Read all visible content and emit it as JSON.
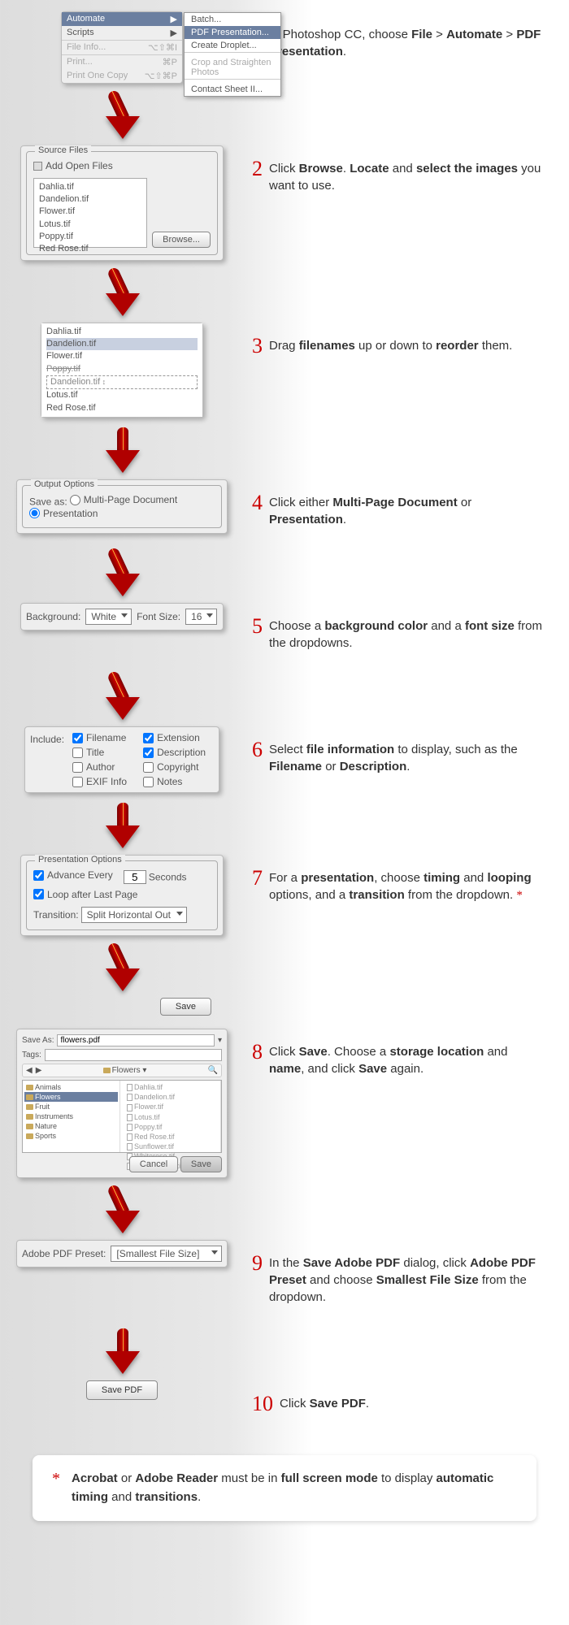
{
  "step1": {
    "menu": {
      "items": [
        {
          "label": "Automate",
          "highlight": true
        },
        {
          "label": "Scripts"
        },
        {
          "label": "File Info...",
          "shortcut": "⌥⇧⌘I",
          "dim": true
        },
        {
          "label": "Print...",
          "shortcut": "⌘P",
          "dim": true
        },
        {
          "label": "Print One Copy",
          "shortcut": "⌥⇧⌘P",
          "dim": true
        }
      ],
      "submenu": [
        "Batch...",
        "PDF Presentation...",
        "Create Droplet...",
        "Crop and Straighten Photos",
        "Contact Sheet II..."
      ],
      "submenu_sel": 1
    },
    "text_pre": "In Photoshop CC, choose ",
    "path1": "File",
    "path2": "Automate",
    "path3": "PDF Presentation"
  },
  "step2": {
    "title": "Source Files",
    "addopen": "Add Open Files",
    "files": [
      "Dahlia.tif",
      "Dandelion.tif",
      "Flower.tif",
      "Lotus.tif",
      "Poppy.tif",
      "Red Rose.tif"
    ],
    "browse": "Browse...",
    "text_a": "Click ",
    "b1": "Browse",
    "text_b": ". ",
    "b2": "Locate",
    "text_c": " and ",
    "b3": "select the images",
    "text_d": " you want to use."
  },
  "step3": {
    "files": [
      "Dahlia.tif",
      "Dandelion.tif",
      "Flower.tif",
      "Poppy.tif",
      "Lotus.tif",
      "Red Rose.tif"
    ],
    "sel": 1,
    "drag": "Dandelion.tif",
    "text_a": "Drag ",
    "b1": "filenames",
    "text_b": " up or down to ",
    "b2": "reorder",
    "text_c": " them."
  },
  "step4": {
    "title": "Output Options",
    "label": "Save as:",
    "opt1": "Multi-Page Document",
    "opt2": "Presentation",
    "text_a": "Click either ",
    "b1": "Multi-Page Document",
    "text_b": " or ",
    "b2": "Presentation",
    "text_c": "."
  },
  "step5": {
    "bglabel": "Background:",
    "bgval": "White",
    "fslabel": "Font Size:",
    "fsval": "16",
    "text_a": "Choose a ",
    "b1": "background color",
    "text_b": " and a ",
    "b2": "font size",
    "text_c": " from the dropdowns."
  },
  "step6": {
    "label": "Include:",
    "checks": [
      {
        "label": "Filename",
        "checked": true
      },
      {
        "label": "Extension",
        "checked": true
      },
      {
        "label": "Title",
        "checked": false
      },
      {
        "label": "Description",
        "checked": true
      },
      {
        "label": "Author",
        "checked": false
      },
      {
        "label": "Copyright",
        "checked": false
      },
      {
        "label": "EXIF Info",
        "checked": false
      },
      {
        "label": "Notes",
        "checked": false
      }
    ],
    "text_a": "Select ",
    "b1": "file information",
    "text_b": " to display, such as the ",
    "b2": "Filename",
    "text_c": " or ",
    "b3": "Description",
    "text_d": "."
  },
  "step7": {
    "title": "Presentation Options",
    "adv_label": "Advance Every",
    "adv_val": "5",
    "adv_unit": "Seconds",
    "loop": "Loop after Last Page",
    "trans_label": "Transition:",
    "trans_val": "Split Horizontal Out",
    "text_a": "For a ",
    "b1": "presentation",
    "text_b": ", choose ",
    "b2": "timing",
    "text_c": " and ",
    "b3": "looping",
    "text_d": " options, and a ",
    "b4": "transition",
    "text_e": " from the dropdown. ",
    "star": "*"
  },
  "step8btn": "Save",
  "step8": {
    "saveas_lbl": "Save As:",
    "saveas_val": "flowers.pdf",
    "tags_lbl": "Tags:",
    "loc_val": "Flowers",
    "col1": [
      "Animals",
      "Flowers",
      "Fruit",
      "Instruments",
      "Nature",
      "Sports"
    ],
    "col1_sel": 1,
    "col2": [
      "Dahlia.tif",
      "Dandelion.tif",
      "Flower.tif",
      "Lotus.tif",
      "Poppy.tif",
      "Red Rose.tif",
      "Sunflower.tif",
      "Whiterose.tif",
      "Yellow Daisy.tif"
    ],
    "cancel": "Cancel",
    "save": "Save",
    "text_a": "Click ",
    "b1": "Save",
    "text_b": ". Choose a ",
    "b2": "storage location",
    "text_c": " and ",
    "b3": "name",
    "text_d": ", and click ",
    "b4": "Save",
    "text_e": " again."
  },
  "step9": {
    "label": "Adobe PDF Preset:",
    "val": "[Smallest File Size]",
    "text_a": "In the ",
    "b1": "Save Adobe PDF",
    "text_b": " dialog, click ",
    "b2": "Adobe PDF Preset",
    "text_c": " and choose ",
    "b3": "Smallest File Size",
    "text_d": " from the dropdown."
  },
  "step10": {
    "btn": "Save PDF",
    "text_a": "Click ",
    "b1": "Save PDF",
    "text_c": "."
  },
  "footnote": {
    "star": "*",
    "a": "Acrobat",
    "b": " or ",
    "c": "Adobe Reader",
    "d": " must be in ",
    "e": "full screen mode",
    "f": " to display ",
    "g": "automatic timing",
    "h": " and ",
    "i": "transitions",
    "j": "."
  }
}
